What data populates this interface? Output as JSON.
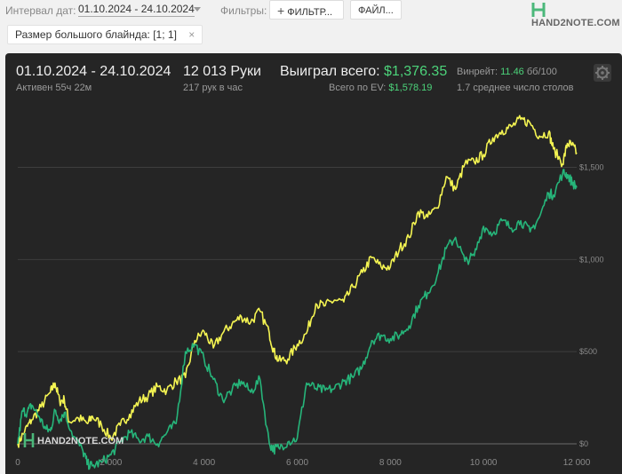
{
  "filters_bar": {
    "interval_label": "Интервал дат:",
    "date_range": "01.10.2024 - 24.10.2024",
    "filters_label": "Фильтры:",
    "filter_button": "ФИЛЬТР...",
    "files_button": "ФАЙЛ...",
    "brand": "HAND2NOTE.COM"
  },
  "chips": [
    {
      "label": "Размер большого блайнда: [1; 1]",
      "close": "×"
    }
  ],
  "summary": {
    "period": "01.10.2024 - 24.10.2024",
    "active": "Активен 55ч 22м",
    "hands": "12 013 Руки",
    "hands_per_hour": "217 рук в час",
    "won_label": "Выиграл всего:",
    "won_value": "$1,376.35",
    "ev_label": "Всего по EV:",
    "ev_value": "$1,578.19",
    "winrate_label": "Винрейт:",
    "winrate_value": "11.46",
    "winrate_unit": "бб/100",
    "tables": "1.7 среднее число столов"
  },
  "colors": {
    "accent": "#4cd37a",
    "ev_line": "#f4f452",
    "won_line": "#26b57a",
    "panel": "#252525"
  },
  "chart_data": {
    "type": "line",
    "x_ticks": [
      "0",
      "2 000",
      "4 000",
      "6 000",
      "8 000",
      "10 000",
      "12 000"
    ],
    "y_ticks": [
      "$0",
      "$500",
      "$1,000",
      "$1,500"
    ],
    "xlim": [
      0,
      12000
    ],
    "ylim": [
      -130,
      1830
    ],
    "grid": true,
    "watermark": "HAND2NOTE.COM",
    "series": [
      {
        "key": "ev",
        "color": "#f4f452",
        "x": [
          0,
          150,
          300,
          500,
          700,
          800,
          900,
          1000,
          1100,
          1300,
          1500,
          1600,
          1800,
          2000,
          2200,
          2400,
          2600,
          2800,
          3000,
          3200,
          3400,
          3600,
          3800,
          4000,
          4200,
          4400,
          4600,
          4800,
          5000,
          5200,
          5400,
          5500,
          5600,
          5800,
          6000,
          6200,
          6400,
          6600,
          6800,
          7000,
          7200,
          7400,
          7600,
          7800,
          8000,
          8200,
          8400,
          8600,
          8800,
          9000,
          9200,
          9400,
          9600,
          9800,
          10000,
          10200,
          10400,
          10600,
          10800,
          11000,
          11200,
          11400,
          11500,
          11700,
          11800,
          11900,
          12000
        ],
        "y": [
          0,
          70,
          130,
          200,
          280,
          330,
          230,
          240,
          120,
          140,
          110,
          150,
          100,
          30,
          100,
          160,
          230,
          260,
          310,
          290,
          340,
          360,
          560,
          610,
          520,
          600,
          650,
          690,
          660,
          720,
          600,
          500,
          450,
          460,
          540,
          600,
          760,
          750,
          780,
          770,
          850,
          930,
          1010,
          960,
          960,
          1060,
          1120,
          1260,
          1230,
          1280,
          1450,
          1380,
          1520,
          1530,
          1570,
          1660,
          1700,
          1720,
          1760,
          1740,
          1670,
          1690,
          1600,
          1520,
          1630,
          1620,
          1580
        ]
      },
      {
        "key": "won",
        "color": "#26b57a",
        "x": [
          0,
          100,
          200,
          300,
          450,
          600,
          700,
          800,
          900,
          1000,
          1200,
          1400,
          1500,
          1600,
          1800,
          2000,
          2200,
          2400,
          2600,
          2800,
          3000,
          3200,
          3400,
          3600,
          3800,
          4000,
          4200,
          4400,
          4600,
          4800,
          5000,
          5200,
          5400,
          5500,
          5600,
          5800,
          6000,
          6200,
          6400,
          6600,
          6800,
          7000,
          7200,
          7400,
          7600,
          7800,
          8000,
          8200,
          8400,
          8600,
          8800,
          9000,
          9200,
          9400,
          9600,
          9800,
          10000,
          10200,
          10400,
          10600,
          10800,
          11000,
          11200,
          11400,
          11500,
          11700,
          11800,
          11900,
          12000
        ],
        "y": [
          0,
          180,
          170,
          210,
          150,
          80,
          70,
          180,
          130,
          170,
          40,
          -40,
          -110,
          -120,
          -100,
          -60,
          10,
          60,
          20,
          40,
          0,
          60,
          110,
          500,
          540,
          460,
          350,
          240,
          290,
          340,
          280,
          350,
          0,
          -30,
          -20,
          10,
          30,
          330,
          300,
          290,
          300,
          340,
          360,
          420,
          560,
          590,
          570,
          590,
          640,
          750,
          820,
          910,
          1060,
          1120,
          990,
          1020,
          1180,
          1140,
          1210,
          1170,
          1210,
          1150,
          1230,
          1360,
          1350,
          1470,
          1460,
          1420,
          1390
        ]
      }
    ]
  }
}
